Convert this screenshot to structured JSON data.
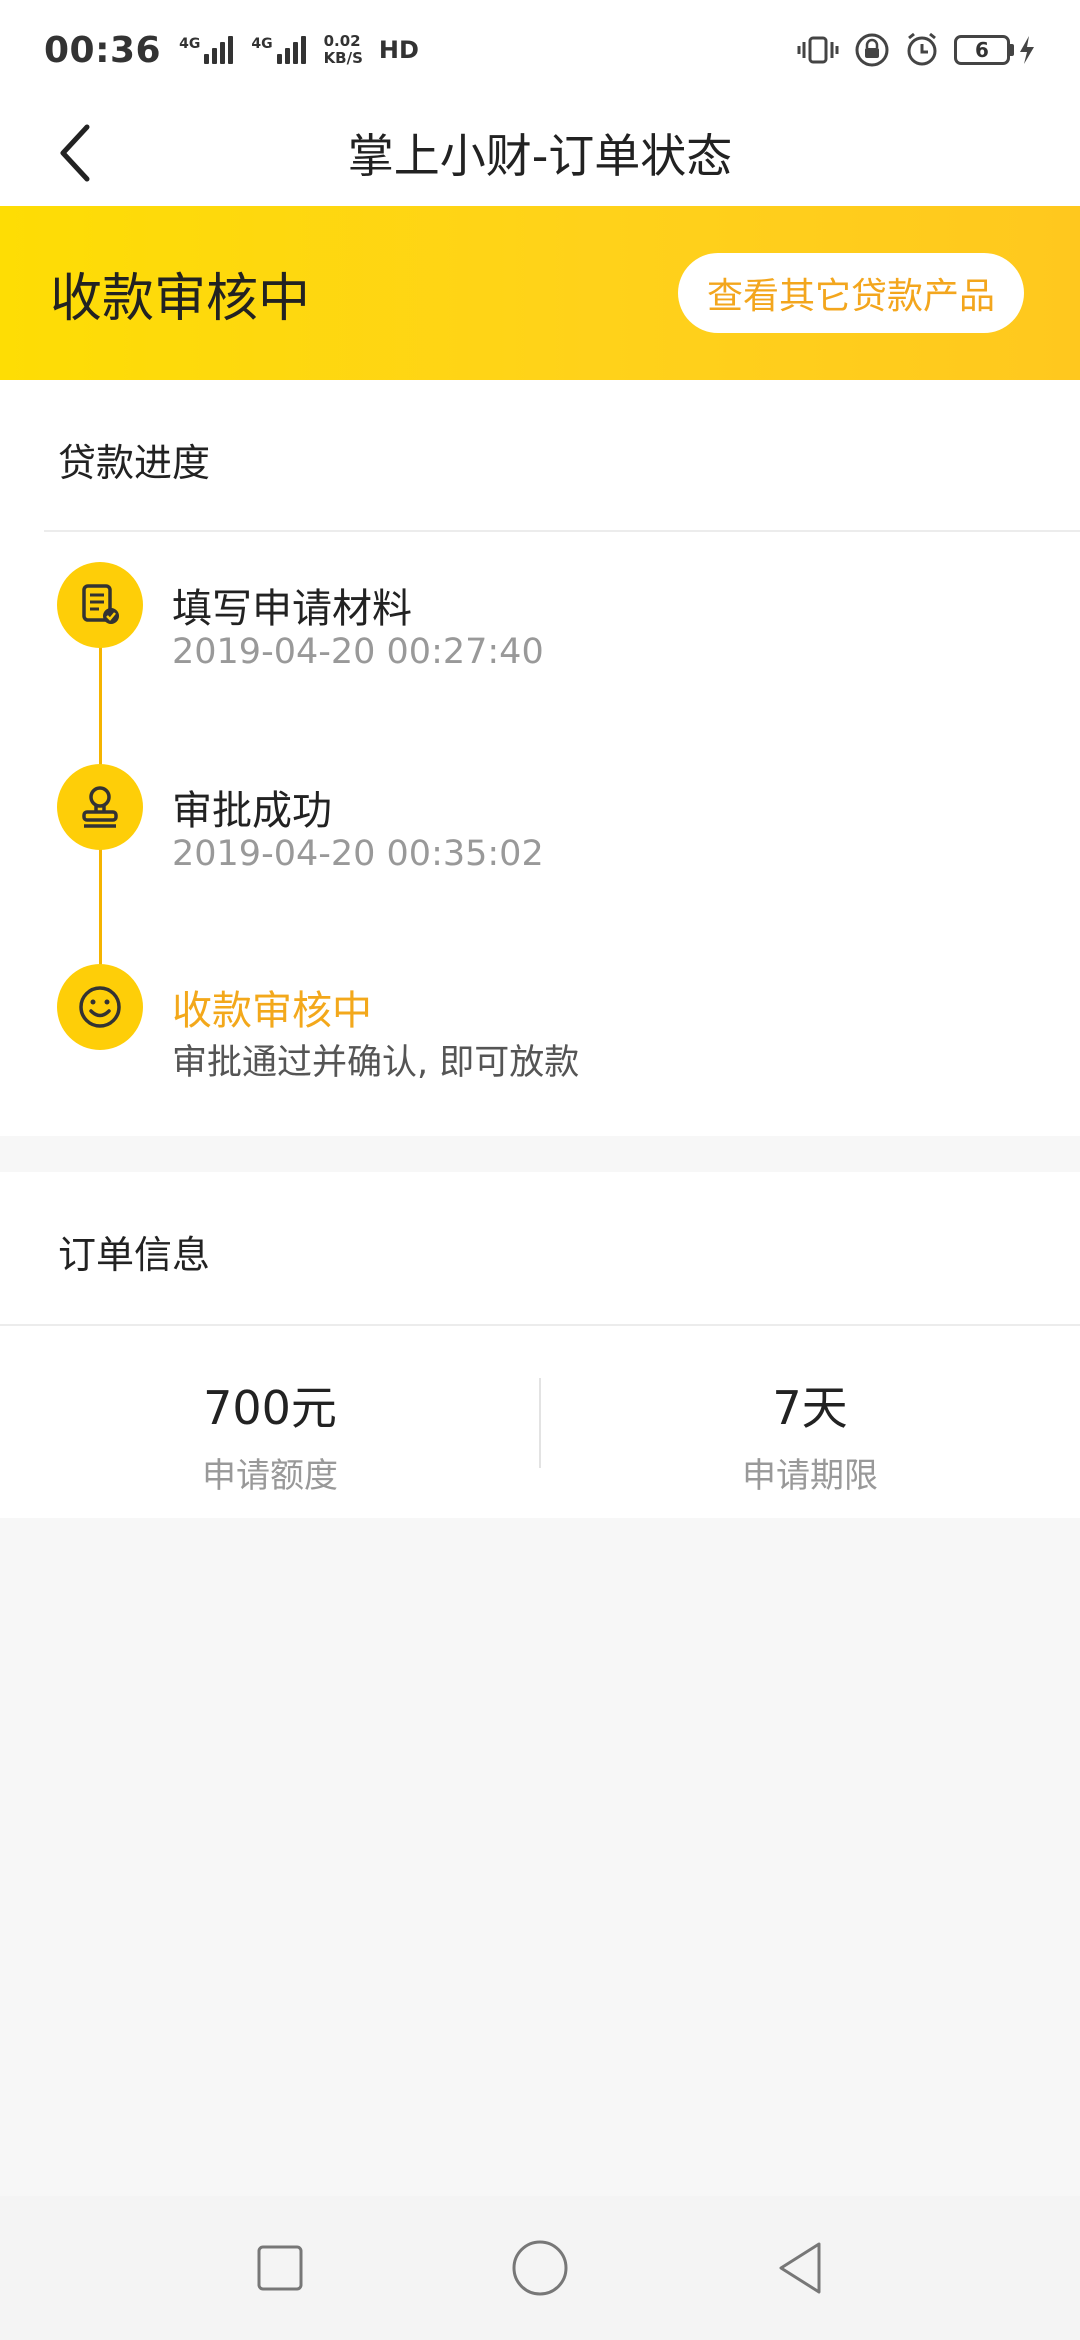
{
  "status_bar": {
    "time": "00:36",
    "network_tags": [
      "4G",
      "4G"
    ],
    "speed_value": "0.02",
    "speed_unit": "KB/S",
    "hd_label": "HD",
    "battery_level": "6"
  },
  "navbar": {
    "title": "掌上小财-订单状态"
  },
  "banner": {
    "status": "收款审核中",
    "button_label": "查看其它贷款产品",
    "accent_color": "#fece08",
    "button_text_color": "#f3a61d"
  },
  "progress": {
    "section_title": "贷款进度",
    "steps": [
      {
        "title": "填写申请材料",
        "subtitle": "2019-04-20 00:27:40",
        "icon": "document-check-icon"
      },
      {
        "title": "审批成功",
        "subtitle": "2019-04-20 00:35:02",
        "icon": "stamp-icon"
      },
      {
        "title": "收款审核中",
        "subtitle": "审批通过并确认, 即可放款",
        "icon": "smiley-icon"
      }
    ]
  },
  "order_info": {
    "section_title": "订单信息",
    "amount_value": "700元",
    "amount_label": "申请额度",
    "term_value": "7天",
    "term_label": "申请期限"
  },
  "system_nav": {
    "icons": [
      "recent-apps-icon",
      "home-icon",
      "back-triangle-icon"
    ]
  }
}
